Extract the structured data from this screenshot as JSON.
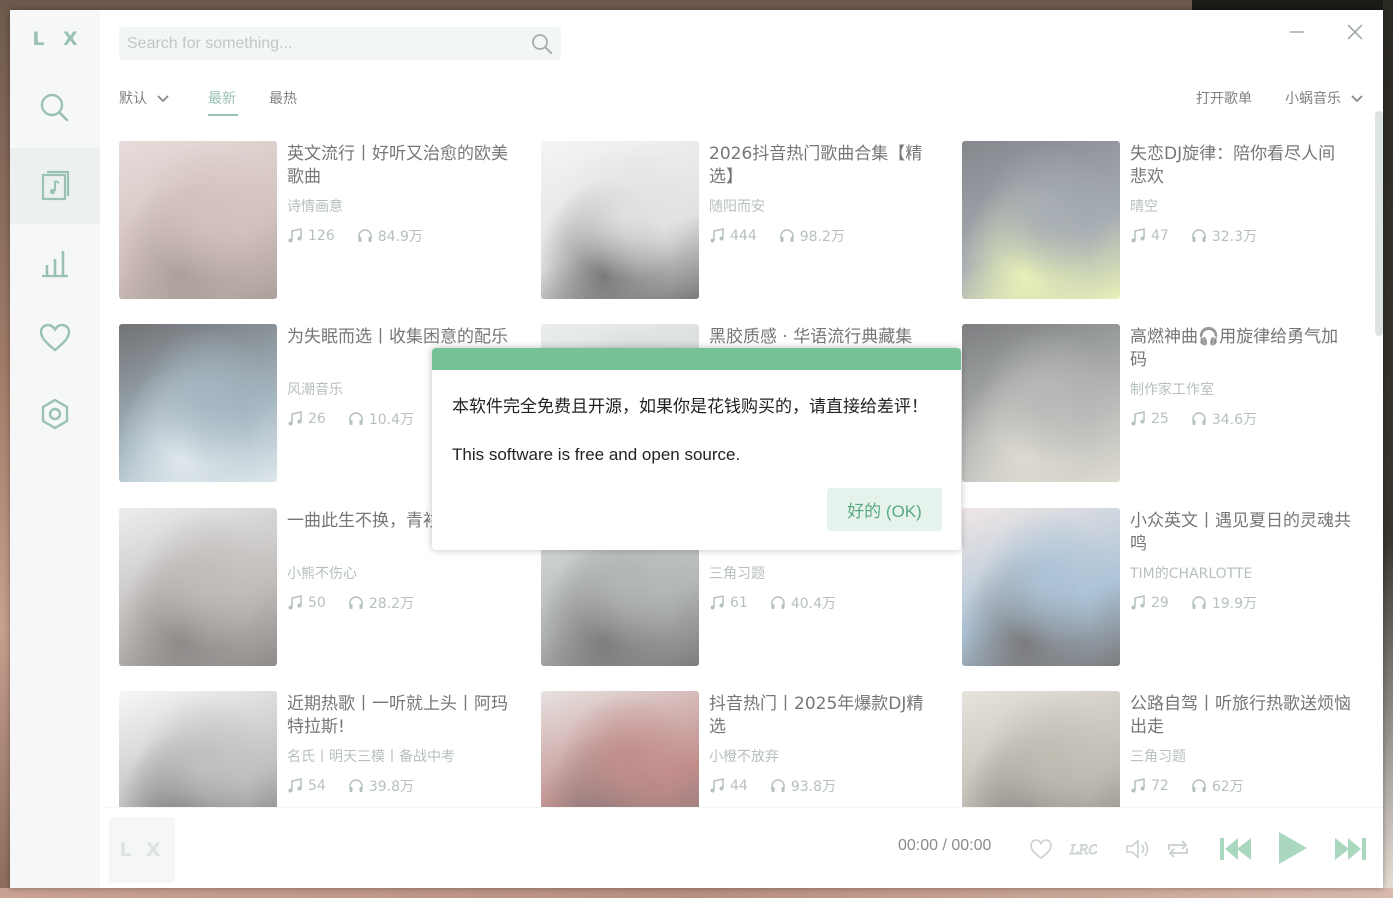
{
  "app": {
    "logo": "L X"
  },
  "search": {
    "placeholder": "Search for something..."
  },
  "sidebar": {
    "items": [
      {
        "name": "search",
        "icon": "search-icon",
        "active": false
      },
      {
        "name": "song-list",
        "icon": "music-list-icon",
        "active": true
      },
      {
        "name": "leaderboard",
        "icon": "chart-bars-icon",
        "active": false
      },
      {
        "name": "favorites",
        "icon": "heart-icon",
        "active": false
      },
      {
        "name": "settings",
        "icon": "hexagon-gear-icon",
        "active": false
      }
    ]
  },
  "tabs": {
    "sort_label": "默认",
    "newest": "最新",
    "hot": "最热",
    "open_playlist": "打开歌单",
    "source": "小蜗音乐"
  },
  "playlists": [
    {
      "title": "英文流行丨好听又治愈的欧美歌曲",
      "author": "诗情画意",
      "songs": "126",
      "plays": "84.9万",
      "cover_colors": [
        "#d8c7c4",
        "#b89c97",
        "#7a6660"
      ]
    },
    {
      "title": "2026抖音热门歌曲合集【精选】",
      "author": "随阳而安",
      "songs": "444",
      "plays": "98.2万",
      "cover_colors": [
        "#eeeeee",
        "#cfcfcf",
        "#2b2b2b"
      ]
    },
    {
      "title": "失恋DJ旋律：陪你看尽人间悲欢",
      "author": "晴空",
      "songs": "47",
      "plays": "32.3万",
      "cover_colors": [
        "#3a3f47",
        "#707a86",
        "#d9e88c"
      ]
    },
    {
      "title": "为失眠而选丨收集困意的配乐",
      "author": "风潮音乐",
      "songs": "26",
      "plays": "10.4万",
      "cover_colors": [
        "#1b1d21",
        "#6f8a9c",
        "#c9d9e0"
      ]
    },
    {
      "title": "黑胶质感 · 华语流行典藏集",
      "author": "",
      "songs": "",
      "plays": "",
      "cover_colors": [
        "#dfe4e3",
        "#b2bbb9",
        "#6e7674"
      ]
    },
    {
      "title": "高燃神曲🎧用旋律给勇气加码",
      "author": "制作家工作室",
      "songs": "25",
      "plays": "34.6万",
      "cover_colors": [
        "#2c2f33",
        "#8b8f8c",
        "#c9c4b5"
      ]
    },
    {
      "title": "一曲此生不换，青衫湿透人泪",
      "author": "小熊不伤心",
      "songs": "50",
      "plays": "28.2万",
      "cover_colors": [
        "#e0e2e1",
        "#9a9491",
        "#4b4442"
      ]
    },
    {
      "title": "",
      "author": "三角习题",
      "songs": "61",
      "plays": "40.4万",
      "cover_colors": [
        "#c9cfce",
        "#858b88",
        "#2e2e30"
      ]
    },
    {
      "title": "小众英文丨遇见夏日的灵魂共鸣",
      "author": "TIM的CHARLOTTE",
      "songs": "29",
      "plays": "19.9万",
      "cover_colors": [
        "#e6d8d5",
        "#7a9fbf",
        "#2b2b2e"
      ]
    },
    {
      "title": "近期热歌丨一听就上头丨阿玛特拉斯!",
      "author": "名氏丨明天三模丨备战中考",
      "songs": "54",
      "plays": "39.8万",
      "cover_colors": [
        "#f2f2f2",
        "#9a9a9a",
        "#1f1f1f"
      ]
    },
    {
      "title": "抖音热门丨2025年爆款DJ精选",
      "author": "小橙不放弃",
      "songs": "44",
      "plays": "93.8万",
      "cover_colors": [
        "#d8cfcd",
        "#9c4844",
        "#3a2424"
      ]
    },
    {
      "title": "公路自驾丨听旅行热歌送烦恼出走",
      "author": "三角习题",
      "songs": "72",
      "plays": "62万",
      "cover_colors": [
        "#d7d2c8",
        "#9b9384",
        "#3d3a35"
      ]
    }
  ],
  "player": {
    "placeholder_logo": "L X",
    "time": "00:00 / 00:00"
  },
  "dialog": {
    "line1": "本软件完全免费且开源，如果你是花钱购买的，请直接给差评！",
    "line2": "This software is free and open source.",
    "ok_label": "好的 (OK)",
    "accent": "#77c198"
  },
  "colors": {
    "brand": "#5d9c84",
    "sidebar_bg": "#f0f4f3"
  }
}
